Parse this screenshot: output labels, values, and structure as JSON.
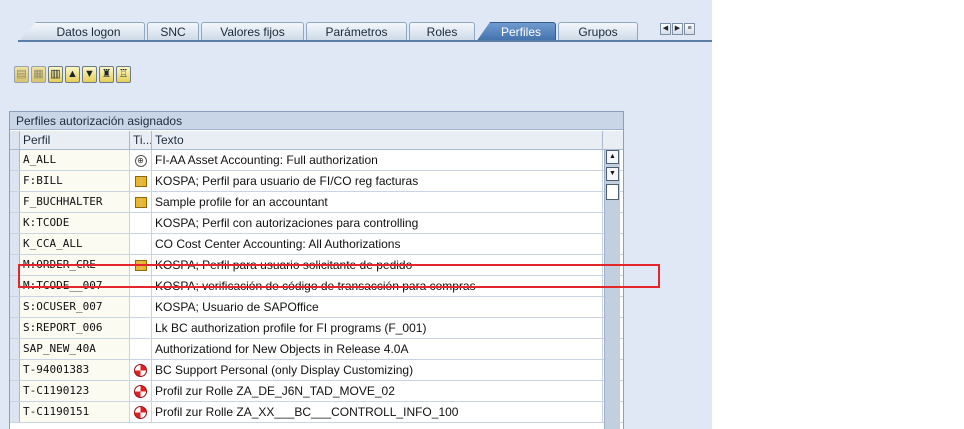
{
  "tabs": [
    {
      "label": "Datos logon",
      "active": false
    },
    {
      "label": "SNC",
      "active": false
    },
    {
      "label": "Valores fijos",
      "active": false
    },
    {
      "label": "Parámetros",
      "active": false
    },
    {
      "label": "Roles",
      "active": false
    },
    {
      "label": "Perfiles",
      "active": true
    },
    {
      "label": "Grupos",
      "active": false
    }
  ],
  "tab_nav": {
    "left": "◀",
    "right": "▶",
    "list": "≡"
  },
  "toolbar": [
    {
      "icon": "detail-icon",
      "glyph": "▤",
      "enabled": false
    },
    {
      "icon": "copy-icon",
      "glyph": "▦",
      "enabled": false
    },
    {
      "icon": "sort-icon",
      "glyph": "▥",
      "enabled": true
    },
    {
      "icon": "print-icon",
      "glyph": "▲",
      "enabled": true
    },
    {
      "icon": "filter-icon",
      "glyph": "▼",
      "enabled": true
    },
    {
      "icon": "find-icon",
      "glyph": "♜",
      "enabled": true
    },
    {
      "icon": "find-next-icon",
      "glyph": "♖",
      "enabled": true
    }
  ],
  "grid": {
    "title": "Perfiles autorización asignados",
    "columns": {
      "perfil": "Perfil",
      "tipo": "Ti...",
      "texto": "Texto"
    },
    "rows": [
      {
        "perfil": "A_ALL",
        "icon": "composite-icon",
        "texto": "FI-AA Asset Accounting: Full authorization"
      },
      {
        "perfil": "F:BILL",
        "icon": "profile-book-icon",
        "texto": "KOSPA; Perfil para usuario de FI/CO reg facturas"
      },
      {
        "perfil": "F_BUCHHALTER",
        "icon": "profile-book-icon",
        "texto": "Sample profile for an accountant"
      },
      {
        "perfil": "K:TCODE",
        "icon": "",
        "texto": "KOSPA; Perfil con autorizaciones para controlling"
      },
      {
        "perfil": "K_CCA_ALL",
        "icon": "",
        "texto": "CO Cost Center Accounting: All Authorizations"
      },
      {
        "perfil": "M:ORDER_CRE",
        "icon": "profile-book-icon",
        "texto": "KOSPA; Perfil para usuario solicitante de pedido"
      },
      {
        "perfil": "M:TCODE__007",
        "icon": "",
        "texto": "KOSPA; verificación de código de transacción para compras"
      },
      {
        "perfil": "S:OCUSER_007",
        "icon": "",
        "texto": "KOSPA; Usuario de SAPOffice"
      },
      {
        "perfil": "S:REPORT_006",
        "icon": "",
        "texto": "Lk BC authorization profile for FI programs (F_001)"
      },
      {
        "perfil": "SAP_NEW_40A",
        "icon": "",
        "texto": "Authorizationd for New Objects in Release 4.0A"
      },
      {
        "perfil": "T-94001383",
        "icon": "role-icon",
        "texto": "BC Support Personal (only Display Customizing)"
      },
      {
        "perfil": "T-C1190123",
        "icon": "role-icon",
        "texto": "Profil zur Rolle ZA_DE_J6N_TAD_MOVE_02"
      },
      {
        "perfil": "T-C1190151",
        "icon": "role-icon",
        "texto": "Profil zur Rolle ZA_XX___BC___CONTROLL_INFO_100"
      }
    ]
  },
  "scrollbar": {
    "up": "▲",
    "down": "▼"
  },
  "highlight": {
    "row": "M:ORDER_CRE",
    "color": "#e2262b"
  },
  "colors": {
    "active_tab": "#4f7fba",
    "panel_bg": "#dfe8f4",
    "highlight": "#e2262b"
  }
}
